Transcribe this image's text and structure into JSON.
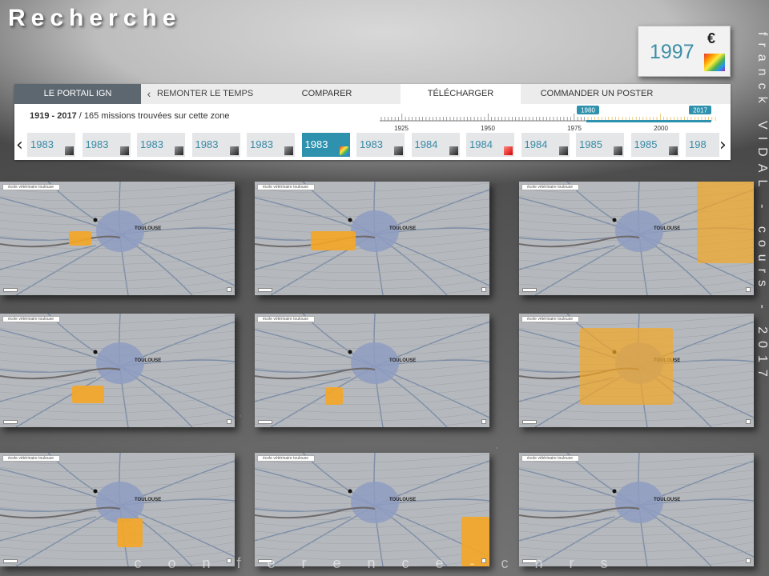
{
  "page_title": "Recherche",
  "side_text": "franck VIDAL   -   cours   -   2017",
  "bottom_text": "c o n f e r e n c e   -   c n r s",
  "year_badge": {
    "year": "1997",
    "currency_symbol": "€",
    "icon": "rainbow-color-icon"
  },
  "nav": {
    "portal": "LE PORTAIL IGN",
    "back_icon": "chevron-left-icon",
    "tabs": [
      "REMONTER LE TEMPS",
      "COMPARER",
      "TÉLÉCHARGER",
      "COMMANDER UN POSTER"
    ],
    "active_tab": "TÉLÉCHARGER"
  },
  "results": {
    "range": "1919 - 2017",
    "summary": "165 missions trouvées sur cette zone"
  },
  "timeline": {
    "ticks": [
      "1925",
      "1950",
      "1975",
      "2000"
    ],
    "range_start": "1980",
    "range_end": "2017",
    "accent": "#2e91ad"
  },
  "thumbnails": [
    {
      "year": "1983",
      "style": "bw"
    },
    {
      "year": "1983",
      "style": "bw"
    },
    {
      "year": "1983",
      "style": "bw"
    },
    {
      "year": "1983",
      "style": "bw"
    },
    {
      "year": "1983",
      "style": "bw"
    },
    {
      "year": "1983",
      "style": "color",
      "active": true
    },
    {
      "year": "1983",
      "style": "bw"
    },
    {
      "year": "1984",
      "style": "bw"
    },
    {
      "year": "1984",
      "style": "red"
    },
    {
      "year": "1984",
      "style": "bw"
    },
    {
      "year": "1985",
      "style": "bw"
    },
    {
      "year": "1985",
      "style": "bw"
    },
    {
      "year": "198",
      "style": "bw"
    }
  ],
  "maps": {
    "search_text": "école vétérinaire toulouse",
    "city_label": "TOULOUSE",
    "footprint_color": "#f5a623"
  }
}
